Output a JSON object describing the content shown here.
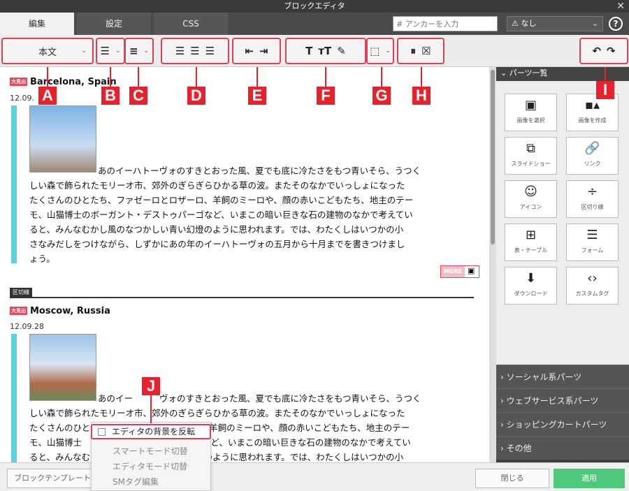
{
  "window": {
    "title": "ブロックエディタ",
    "close": "✕"
  },
  "tabs": [
    {
      "label": "編集"
    },
    {
      "label": "設定"
    },
    {
      "label": "CSS"
    }
  ],
  "anchor_input": {
    "value": "",
    "placeholder": "# アンカーを入力"
  },
  "select": {
    "icon": "⚠",
    "value": "なし",
    "chevron": "⌄"
  },
  "help": "?",
  "toolbar": {
    "block_type": "本文",
    "undo": "↶",
    "redo": "↷"
  },
  "callouts": [
    "A",
    "B",
    "C",
    "D",
    "E",
    "F",
    "G",
    "H",
    "I",
    "J"
  ],
  "blocks": [
    {
      "badge": "大見出",
      "heading": "Barcelona, Spain",
      "date": "12.09.",
      "text": [
        "あのイーハトーヴォのすきとおった風、夏でも底に冷たさをもつ青いそら、うつく",
        "しい森で飾られたモリーオ市、郊外のぎらぎらひかる草の波。またそのなかでいっしょになった",
        "たくさんのひとたち、ファゼーロとロザーロ、羊飼のミーロや、顔の赤いこどもたち、地主のテー",
        "モ、山猫博士のボーガント・デストゥパーゴなど、いまこの暗い巨きな石の建物のなかで考えてい",
        "ると、みんなむかし風のなつかしい青い幻燈のように思われます。では、わたくしはいつかの小",
        "さなみだしをつけながら、しずかにあの年のイーハトーヴォの五月から十月までを書きつけまし",
        "ょう。"
      ]
    },
    {
      "badge": "大見出",
      "heading": "Moscow, Russia",
      "date": "12.09.28",
      "text": [
        "あのイー",
        "ヴォのすきとおった風、夏でも底に冷たさをもつ青いそら、うつく",
        "しい森で飾られたモリーオ市、",
        "郊外のぎらぎらひかる草の波。またそのなかでいっしょになった",
        "たくさんのひと",
        "羊飼のミーロや、顔の赤いこどもたち、地主のテー",
        "モ、山猫博士",
        "など、いまこの暗い巨きな石の建物のなかで考えてい",
        "ると、みんなむ",
        "燈のように思われます。では、わたくしはいつかの小"
      ]
    }
  ],
  "more_tag": "MORE",
  "divider_label": "区切線",
  "sidebar": {
    "header": "パーツ一覧",
    "parts": [
      {
        "icon": "▣",
        "label": "画像を選択"
      },
      {
        "icon": "▪▴",
        "label": "画像を作成"
      },
      {
        "icon": "⧉",
        "label": "スライドショー"
      },
      {
        "icon": "🔗",
        "label": "リンク"
      },
      {
        "icon": "☺",
        "label": "アイコン"
      },
      {
        "icon": "÷",
        "label": "区切り線"
      },
      {
        "icon": "⊞",
        "label": "表・テーブル"
      },
      {
        "icon": "☰",
        "label": "フォーム"
      },
      {
        "icon": "⬇",
        "label": "ダウンロード"
      },
      {
        "icon": "‹›",
        "label": "カスタムタグ"
      }
    ],
    "categories": [
      {
        "label": "ソーシャル系パーツ"
      },
      {
        "label": "ウェブサービス系パーツ"
      },
      {
        "label": "ショッピングカートパーツ"
      },
      {
        "label": "その他"
      }
    ]
  },
  "context_menu": [
    {
      "label": "エディタの背景を反転"
    },
    {
      "label": "スマートモード切替"
    },
    {
      "label": "エディタモード切替"
    },
    {
      "label": "SMタグ編集"
    }
  ],
  "bottom": {
    "template": "ブロックテンプレート",
    "close": "閉じる",
    "apply": "適用"
  }
}
